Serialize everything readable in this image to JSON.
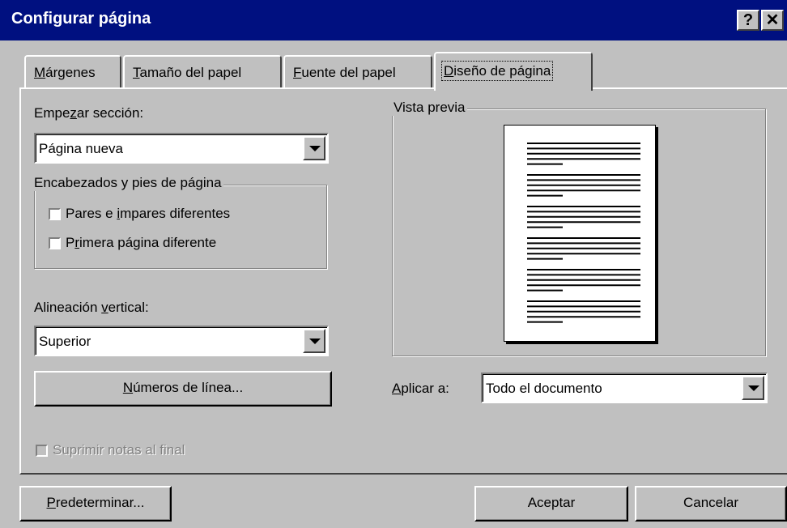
{
  "window": {
    "title": "Configurar página",
    "help_button": "?",
    "close_button": "✕"
  },
  "tabs": [
    {
      "pre": "",
      "key": "M",
      "post": "árgenes"
    },
    {
      "pre": "",
      "key": "T",
      "post": "amaño del papel"
    },
    {
      "pre": "",
      "key": "F",
      "post": "uente del papel"
    },
    {
      "pre": "",
      "key": "D",
      "post": "iseño de página"
    }
  ],
  "section_start": {
    "label_pre": "Empe",
    "label_key": "z",
    "label_post": "ar sección:",
    "value": "Página nueva"
  },
  "headers_group": {
    "title": "Encabezados y pies de página",
    "odd_even": {
      "pre": "Pares e ",
      "key": "i",
      "post": "mpares diferentes",
      "checked": false
    },
    "first_page": {
      "pre": "P",
      "key": "r",
      "post": "imera página diferente",
      "checked": false
    }
  },
  "vertical_alignment": {
    "label_pre": "Alineación ",
    "label_key": "v",
    "label_post": "ertical:",
    "value": "Superior"
  },
  "line_numbers_button": {
    "pre": "",
    "key": "N",
    "post": "úmeros de línea..."
  },
  "suppress_endnotes": {
    "label": "Suprimir notas al final",
    "checked": false
  },
  "preview": {
    "title": "Vista previa"
  },
  "apply_to": {
    "label_pre": "",
    "label_key": "A",
    "label_post": "plicar a:",
    "value": "Todo el documento"
  },
  "buttons": {
    "default": {
      "pre": "",
      "key": "P",
      "post": "redeterminar..."
    },
    "ok": "Aceptar",
    "cancel": "Cancelar"
  },
  "colors": {
    "titlebar": "#001080",
    "face": "#c0c0c0"
  }
}
